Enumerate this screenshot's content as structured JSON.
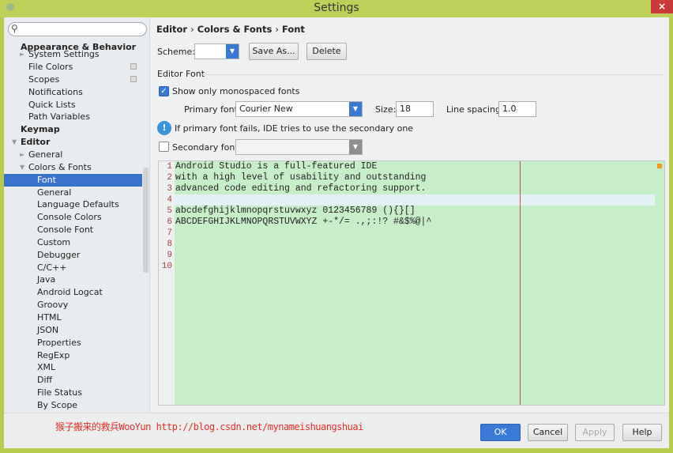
{
  "window": {
    "title": "Settings",
    "close_icon": "×"
  },
  "search": {
    "placeholder": "",
    "icon": "search-icon"
  },
  "sidebar": {
    "items": [
      {
        "label": "Appearance & Behavior",
        "bold": true
      },
      {
        "label": "System Settings"
      },
      {
        "label": "File Colors"
      },
      {
        "label": "Scopes"
      },
      {
        "label": "Notifications"
      },
      {
        "label": "Quick Lists"
      },
      {
        "label": "Path Variables"
      },
      {
        "label": "Keymap",
        "bold": true
      },
      {
        "label": "Editor",
        "bold": true
      },
      {
        "label": "General"
      },
      {
        "label": "Colors & Fonts"
      },
      {
        "label": "Font",
        "selected": true
      },
      {
        "label": "General"
      },
      {
        "label": "Language Defaults"
      },
      {
        "label": "Console Colors"
      },
      {
        "label": "Console Font"
      },
      {
        "label": "Custom"
      },
      {
        "label": "Debugger"
      },
      {
        "label": "C/C++"
      },
      {
        "label": "Java"
      },
      {
        "label": "Android Logcat"
      },
      {
        "label": "Groovy"
      },
      {
        "label": "HTML"
      },
      {
        "label": "JSON"
      },
      {
        "label": "Properties"
      },
      {
        "label": "RegExp"
      },
      {
        "label": "XML"
      },
      {
        "label": "Diff"
      },
      {
        "label": "File Status"
      },
      {
        "label": "By Scope"
      }
    ]
  },
  "breadcrumb": {
    "a": "Editor",
    "b": "Colors & Fonts",
    "c": "Font",
    "sep": "›"
  },
  "scheme": {
    "label": "Scheme:",
    "value": "",
    "save_as": "Save As...",
    "delete": "Delete"
  },
  "editor_font": {
    "section": "Editor Font",
    "show_mono_label": "Show only monospaced fonts",
    "show_mono_checked": true,
    "primary_label": "Primary font:",
    "primary_value": "Courier New",
    "size_label": "Size:",
    "size_value": "18",
    "spacing_label": "Line spacing:",
    "spacing_value": "1.0",
    "info": "If primary font fails, IDE tries to use the secondary one",
    "secondary_label": "Secondary font:",
    "secondary_checked": false,
    "secondary_value": ""
  },
  "preview": {
    "lines": [
      "Android Studio is a full-featured IDE",
      "with a high level of usability and outstanding",
      "advanced code editing and refactoring support.",
      "",
      "abcdefghijklmnopqrstuvwxyz 0123456789 (){}[]",
      "ABCDEFGHIJKLMNOPQRSTUVWXYZ +-*/= .,;:!? #&$%@|^",
      "",
      "",
      "",
      ""
    ],
    "numbers": [
      "1",
      "2",
      "3",
      "4",
      "5",
      "6",
      "7",
      "8",
      "9",
      "10"
    ]
  },
  "watermark": "猴子搬来的救兵WooYun http://blog.csdn.net/mynameishuangshuai",
  "footer": {
    "ok": "OK",
    "cancel": "Cancel",
    "apply": "Apply",
    "help": "Help"
  },
  "colors": {
    "accent": "#3a73cb",
    "preview_bg": "#c8edc9",
    "titlebar": "#bfd05a"
  }
}
